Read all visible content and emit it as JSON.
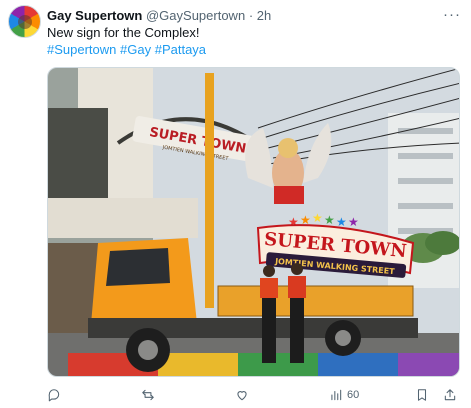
{
  "tweet": {
    "author_name": "Gay Supertown",
    "author_handle": "@GaySupertown",
    "separator": "·",
    "time": "2h",
    "more_label": "···",
    "text": "New sign for the Complex!",
    "hashtags": [
      "#Supertown",
      "#Gay",
      "#Pattaya"
    ],
    "media": {
      "sign_title": "SUPER TOWN",
      "sign_subtitle": "JOMTIEN WALKING STREET",
      "arch_text": "SUPER TOWN",
      "arch_subtitle": "JOMTIEN WALKING STREET"
    },
    "actions": {
      "reply_count": "",
      "retweet_count": "",
      "like_count": "",
      "views_count": "60"
    }
  },
  "colors": {
    "link": "#1d9bf0",
    "muted": "#536471",
    "truck": "#f39a1b",
    "sign_red": "#c4161c"
  },
  "icons": [
    "more-icon",
    "reply-icon",
    "retweet-icon",
    "like-icon",
    "views-icon",
    "bookmark-icon",
    "share-icon"
  ]
}
